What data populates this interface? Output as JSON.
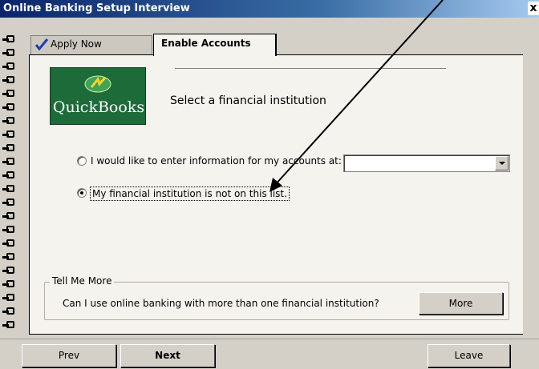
{
  "window": {
    "title": "Online Banking Setup Interview",
    "close_glyph": "x"
  },
  "tabs": [
    {
      "label": "Apply Now",
      "icon": "checkmark-icon"
    },
    {
      "label": "Enable Accounts",
      "active": true
    }
  ],
  "logo": {
    "brand": "QuickBooks"
  },
  "main": {
    "heading": "Select a financial institution",
    "options": [
      {
        "label": "I would like to enter information for my accounts at:",
        "selected": false
      },
      {
        "label": "My financial institution is not on this list.",
        "selected": true
      }
    ],
    "institution_select": {
      "value": ""
    }
  },
  "tell_me_more": {
    "title": "Tell Me More",
    "question": "Can I use online banking with more than one financial institution?",
    "more_label": "More"
  },
  "footer": {
    "prev_label": "Prev",
    "next_label": "Next",
    "leave_label": "Leave"
  },
  "colors": {
    "titlebar": "#0a246a",
    "logo_bg": "#1e6b3a",
    "page_bg": "#f4f3ee",
    "window_bg": "#d4d0c8"
  }
}
